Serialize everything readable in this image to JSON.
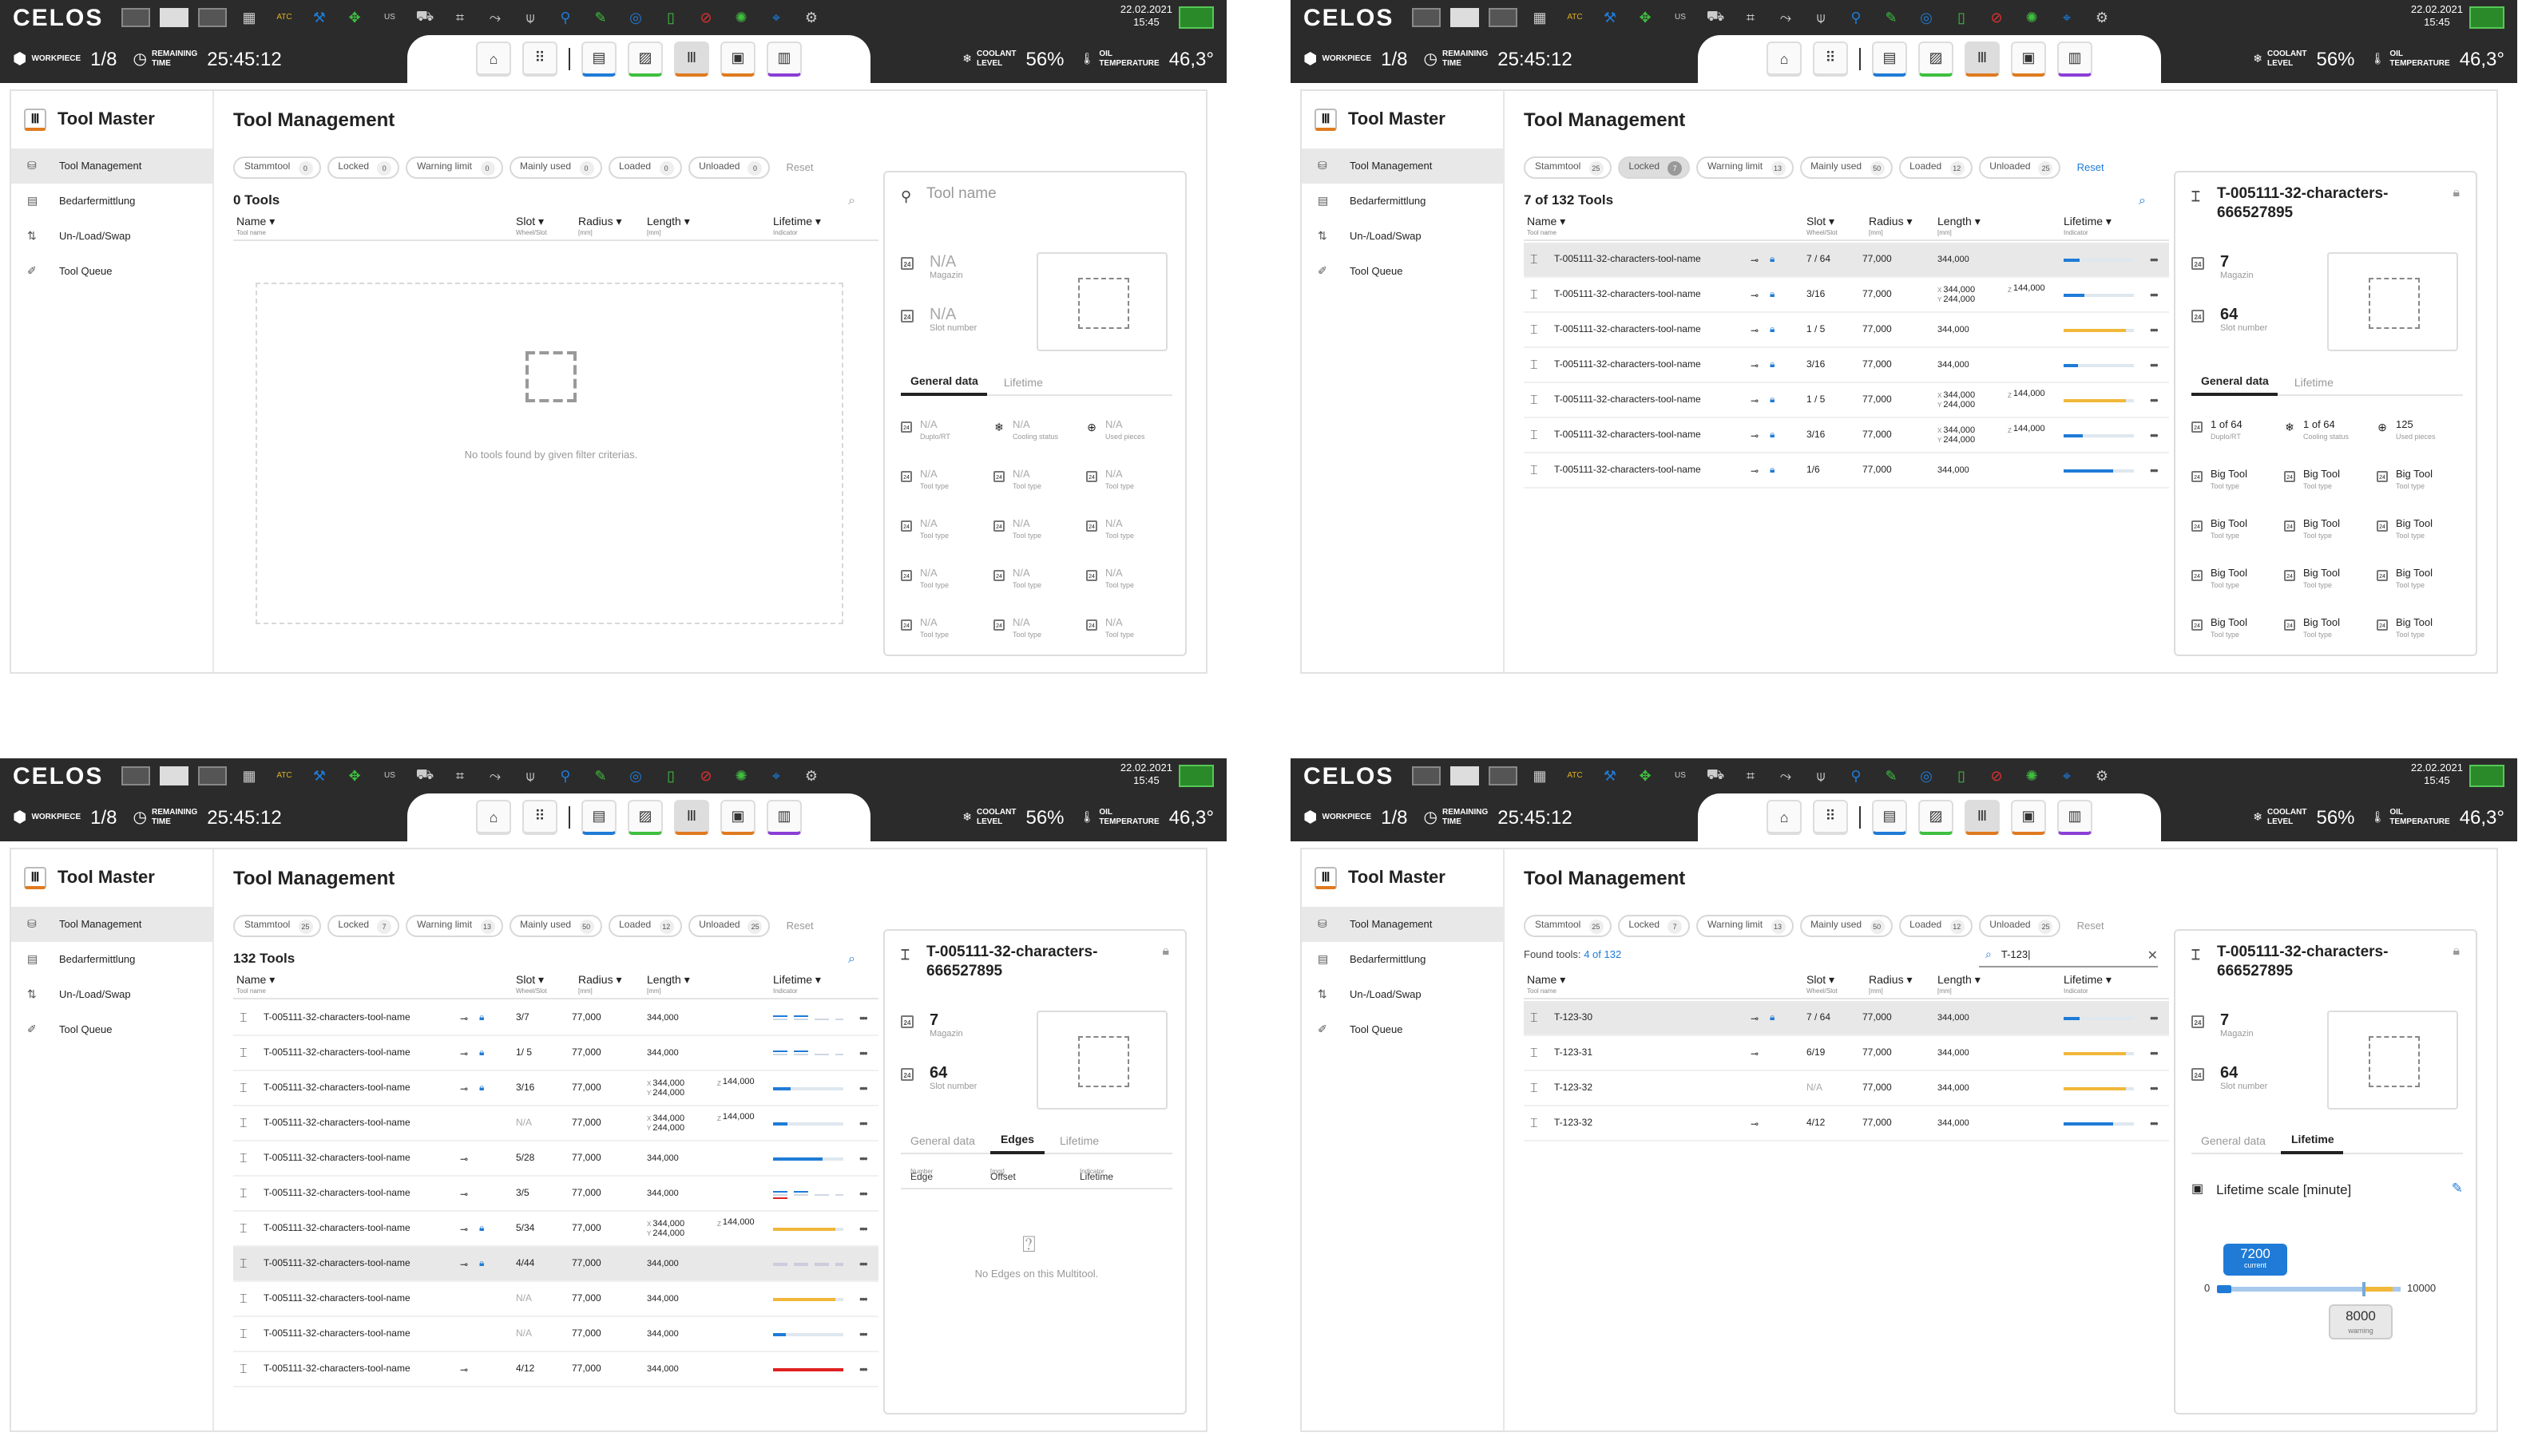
{
  "app": {
    "logo": "CELOS",
    "date": "22.02.2021",
    "time": "15:45",
    "workpiece_label": "WORKPIECE",
    "workpiece_value": "1/8",
    "remaining_label_1": "REMAINING",
    "remaining_label_2": "TIME",
    "remaining_value": "25:45:12",
    "coolant_label_1": "COOLANT",
    "coolant_label_2": "LEVEL",
    "coolant_value": "56%",
    "oil_label_1": "OIL",
    "oil_label_2": "TEMPERATURE",
    "oil_value": "46,3°",
    "top_icons": [
      "ATC",
      "US"
    ]
  },
  "sidebar": {
    "title": "Tool Master",
    "items": [
      "Tool Management",
      "Bedarfermittlung",
      "Un-/Load/Swap",
      "Tool Queue"
    ]
  },
  "page_title": "Tool Management",
  "filters": {
    "labels": [
      "Stammtool",
      "Locked",
      "Warning limit",
      "Mainly used",
      "Loaded",
      "Unloaded"
    ],
    "reset": "Reset"
  },
  "columns": {
    "name": "Name",
    "name_sub": "Tool name",
    "slot": "Slot",
    "slot_sub": "Wheel/Slot",
    "radius": "Radius",
    "radius_sub": "[mm]",
    "length": "Length",
    "length_sub": "[mm]",
    "lifetime": "Lifetime",
    "lifetime_sub": "Indicator"
  },
  "detail_labels": {
    "magazin": "Magazin",
    "slot_number": "Slot number",
    "tab_general": "General data",
    "tab_lifetime": "Lifetime",
    "tab_edges": "Edges",
    "duplo": "Duplo/RT",
    "cooling": "Cooling status",
    "used": "Used pieces",
    "tool_type": "Tool type"
  },
  "screens": [
    {
      "counts": [
        "0",
        "0",
        "0",
        "0",
        "0",
        "0"
      ],
      "selected_chip": -1,
      "reset_active": false,
      "count_text": "0 Tools",
      "empty_text": "No tools found by given filter criterias.",
      "rows": [],
      "detail": {
        "placeholder": true,
        "title": "Tool name",
        "magazin": "N/A",
        "slot": "N/A",
        "tab": "general",
        "grid": [
          "N/A",
          "N/A",
          "N/A",
          "N/A",
          "N/A",
          "N/A",
          "N/A",
          "N/A",
          "N/A",
          "N/A",
          "N/A",
          "N/A",
          "N/A",
          "N/A",
          "N/A"
        ]
      }
    },
    {
      "counts": [
        "25",
        "7",
        "13",
        "50",
        "12",
        "25"
      ],
      "selected_chip": 1,
      "reset_active": true,
      "count_text": "7 of 132 Tools",
      "rows": [
        {
          "name": "T-005111-32-characters-tool-name",
          "slot": "7 / 64",
          "radius": "77,000",
          "length": "344,000",
          "lock": true,
          "sel": true,
          "bar": "b",
          "life": 0.22
        },
        {
          "name": "T-005111-32-characters-tool-name",
          "slot": "3/16",
          "radius": "77,000",
          "lx": "344,000",
          "ly": "244,000",
          "lz": "144,000",
          "lock": true,
          "bar": "b",
          "life": 0.3
        },
        {
          "name": "T-005111-32-characters-tool-name",
          "slot": "1 / 5",
          "radius": "77,000",
          "length": "344,000",
          "lock": true,
          "bar": "y",
          "life": 0.88
        },
        {
          "name": "T-005111-32-characters-tool-name",
          "slot": "3/16",
          "radius": "77,000",
          "length": "344,000",
          "lock": true,
          "bar": "b",
          "life": 0.2
        },
        {
          "name": "T-005111-32-characters-tool-name",
          "slot": "1 / 5",
          "radius": "77,000",
          "lx": "344,000",
          "ly": "244,000",
          "lz": "144,000",
          "lock": true,
          "bar": "y",
          "life": 0.88
        },
        {
          "name": "T-005111-32-characters-tool-name",
          "slot": "3/16",
          "radius": "77,000",
          "lx": "344,000",
          "ly": "244,000",
          "lz": "144,000",
          "lock": true,
          "bar": "b",
          "life": 0.28
        },
        {
          "name": "T-005111-32-characters-tool-name",
          "slot": "1/6",
          "radius": "77,000",
          "length": "344,000",
          "lock": true,
          "bar": "b",
          "life": 0.7
        }
      ],
      "detail": {
        "placeholder": false,
        "title": "T-005111-32-characters-666527895",
        "magazin": "7",
        "slot": "64",
        "tab": "general",
        "grid": [
          "1 of 64",
          "1 of 64",
          "125",
          "Big Tool",
          "Big Tool",
          "Big Tool",
          "Big Tool",
          "Big Tool",
          "Big Tool",
          "Big Tool",
          "Big Tool",
          "Big Tool",
          "Big Tool",
          "Big Tool",
          "Big Tool"
        ]
      }
    },
    {
      "counts": [
        "25",
        "7",
        "13",
        "50",
        "12",
        "25"
      ],
      "selected_chip": -1,
      "reset_active": false,
      "count_text": "132 Tools",
      "search_blue": true,
      "rows": [
        {
          "name": "T-005111-32-characters-tool-name",
          "slot": "3/7",
          "radius": "77,000",
          "length": "344,000",
          "lock": true,
          "bar": "multi"
        },
        {
          "name": "T-005111-32-characters-tool-name",
          "slot": "1/ 5",
          "radius": "77,000",
          "length": "344,000",
          "lock": true,
          "bar": "multi"
        },
        {
          "name": "T-005111-32-characters-tool-name",
          "slot": "3/16",
          "radius": "77,000",
          "lx": "344,000",
          "ly": "244,000",
          "lz": "144,000",
          "lock": true,
          "bar": "b",
          "life": 0.25
        },
        {
          "name": "T-005111-32-characters-tool-name",
          "slot": "N/A",
          "na": true,
          "radius": "77,000",
          "lx": "344,000",
          "ly": "244,000",
          "lz": "144,000",
          "lock": false,
          "noic": true,
          "bar": "b",
          "life": 0.2
        },
        {
          "name": "T-005111-32-characters-tool-name",
          "slot": "5/28",
          "radius": "77,000",
          "length": "344,000",
          "lock": false,
          "bar": "b",
          "life": 0.7
        },
        {
          "name": "T-005111-32-characters-tool-name",
          "slot": "3/5",
          "radius": "77,000",
          "length": "344,000",
          "lock": false,
          "bar": "multi2"
        },
        {
          "name": "T-005111-32-characters-tool-name",
          "slot": "5/34",
          "radius": "77,000",
          "lx": "344,000",
          "ly": "244,000",
          "lz": "144,000",
          "lock": true,
          "bar": "y",
          "life": 0.88
        },
        {
          "name": "T-005111-32-characters-tool-name",
          "slot": "4/44",
          "radius": "77,000",
          "length": "344,000",
          "lock": true,
          "sel": true,
          "bar": "dash"
        },
        {
          "name": "T-005111-32-characters-tool-name",
          "slot": "N/A",
          "na": true,
          "radius": "77,000",
          "length": "344,000",
          "lock": false,
          "noic": true,
          "bar": "y",
          "life": 0.88
        },
        {
          "name": "T-005111-32-characters-tool-name",
          "slot": "N/A",
          "na": true,
          "radius": "77,000",
          "length": "344,000",
          "lock": false,
          "noic": true,
          "bar": "b",
          "life": 0.18
        },
        {
          "name": "T-005111-32-characters-tool-name",
          "slot": "4/12",
          "radius": "77,000",
          "length": "344,000",
          "lock": false,
          "bar": "r",
          "life": 1.0
        }
      ],
      "detail": {
        "placeholder": false,
        "title": "T-005111-32-characters-666527895",
        "magazin": "7",
        "slot": "64",
        "tab": "edges",
        "edge_cols": [
          "Edge",
          "Offset",
          "Lifetime"
        ],
        "edge_subs": [
          "Number",
          "[mm]",
          "Indicator"
        ],
        "empty_edges": "No Edges on this Multitool."
      }
    },
    {
      "counts": [
        "25",
        "7",
        "13",
        "50",
        "12",
        "25"
      ],
      "selected_chip": -1,
      "reset_active": false,
      "count_text": "Found tools:",
      "count_link": "4 of 132",
      "search_value": "T-123|",
      "rows": [
        {
          "name": "T-123-30",
          "slot": "7 / 64",
          "radius": "77,000",
          "length": "344,000",
          "lock": true,
          "sel": true,
          "bar": "b",
          "life": 0.22
        },
        {
          "name": "T-123-31",
          "slot": "6/19",
          "radius": "77,000",
          "length": "344,000",
          "lock": false,
          "bar": "y",
          "life": 0.88
        },
        {
          "name": "T-123-32",
          "slot": "N/A",
          "na": true,
          "radius": "77,000",
          "length": "344,000",
          "lock": false,
          "noic": true,
          "bar": "y",
          "life": 0.88
        },
        {
          "name": "T-123-32",
          "slot": "4/12",
          "radius": "77,000",
          "length": "344,000",
          "lock": false,
          "bar": "b",
          "life": 0.7
        }
      ],
      "detail": {
        "placeholder": false,
        "title": "T-005111-32-characters-666527895",
        "magazin": "7",
        "slot": "64",
        "tab": "lifetime",
        "lifetime_title": "Lifetime scale [minute]",
        "min": "0",
        "max": "10000",
        "current": "7200",
        "current_label": "current",
        "warning": "8000",
        "warning_label": "warning",
        "current_fraction": 0.72,
        "warning_fraction": 0.8
      }
    }
  ]
}
